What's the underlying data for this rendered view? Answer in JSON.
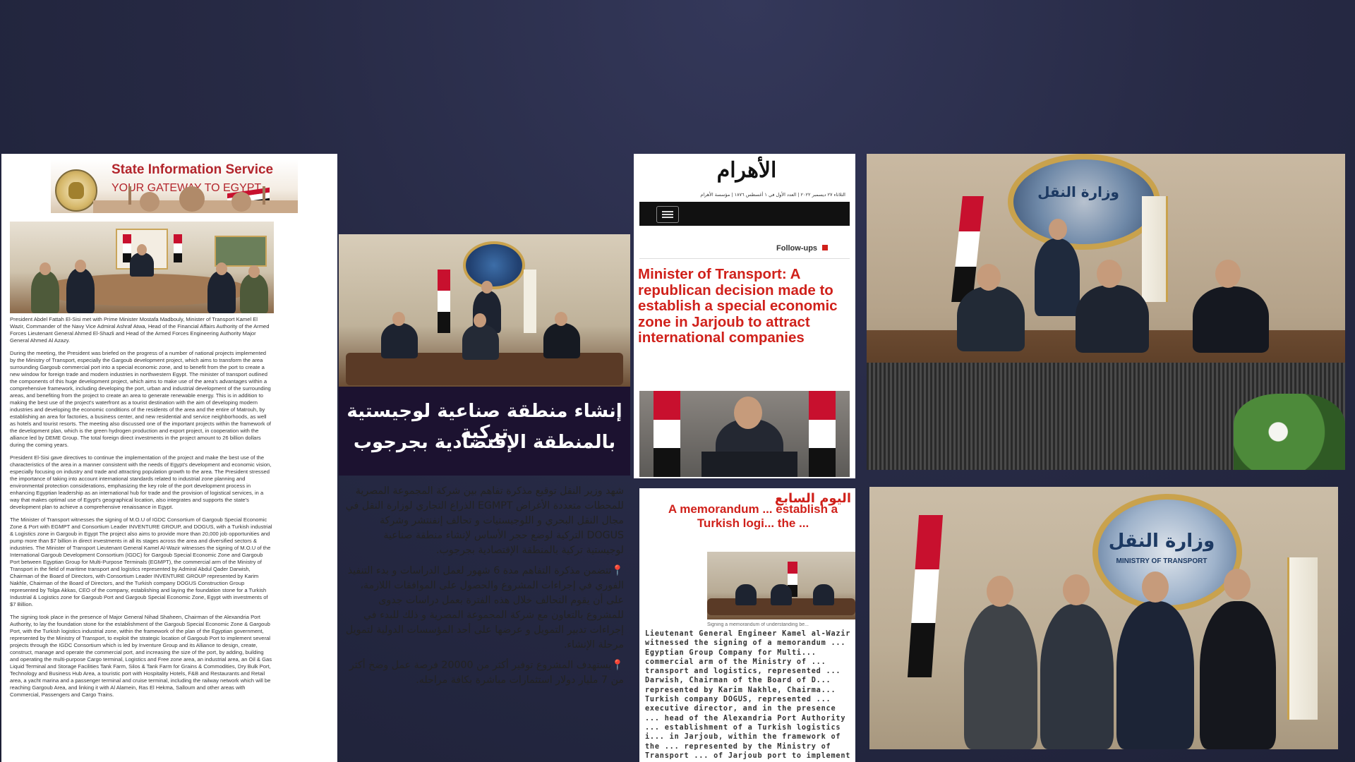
{
  "sis": {
    "title": "State Information Service",
    "subtitle": "YOUR GATEWAY TO EGYPT"
  },
  "article1": {
    "caption": "President Abdel Fattah El-Sisi met with Prime Minister Mostafa Madbouly, Minister of Transport Kamel El Wazir, Commander of the Navy Vice Admiral Ashraf Atwa, Head of the Financial Affairs Authority of the Armed Forces Lieutenant General Ahmed El-Shazli and Head of the Armed Forces Engineering Authority Major General Ahmed Al Azazy.",
    "p1": "During the meeting, the President was briefed on the progress of a number of national projects implemented by the Ministry of Transport, especially the Gargoub development project, which aims to transform the area surrounding Gargoub commercial port into a special economic zone, and to benefit from the port to create a new window for foreign trade and modern industries in northwestern Egypt. The minister of transport outlined the components of this huge development project, which aims to make use of the area's advantages within a comprehensive framework, including developing the port, urban and industrial development of the surrounding areas, and benefiting from the project to create an area to generate renewable energy. This is in addition to making the best use of the project's waterfront as a tourist destination with the aim of developing modern industries and developing the economic conditions of the residents of the area and the entire of Matrouh, by establishing an area for factories, a business center, and new residential and service neighborhoods, as well as hotels and tourist resorts. The meeting also discussed one of the important projects within the framework of the development plan, which is the green hydrogen production and export project, in cooperation with the alliance led by DEME Group. The total foreign direct investments in the project amount to 26 billion dollars during the coming years.",
    "p2": "President El-Sisi gave directives to continue the implementation of the project and make the best use of the characteristics of the area in a manner consistent with the needs of Egypt's development and economic vision, especially focusing on industry and trade and attracting population growth to the area. The President stressed the importance of taking into account international standards related to industrial zone planning and environmental protection considerations, emphasizing the key role of the port development process in enhancing Egyptian leadership as an international hub for trade and the provision of logistical services, in a way that makes optimal use of Egypt's geographical location, also integrates and supports the state's development plan to achieve a comprehensive renaissance in Egypt.",
    "p3": "The Minister of Transport witnesses the signing of M.O.U of IGDC Consortium of Gargoub Special Economic Zone & Port with EGMPT and Consortium Leader INVENTURE GROUP, and DOGUS, with a Turkish industrial & Logistics zone in Gargoub in Egypt The project also aims to provide more than 20,000 job opportunities and pump more than $7 billion in direct investments in all its stages across the area and diversified sectors & industries. The Minister of Transport Lieutenant General Kamel Al-Wazir witnesses the signing of M.O.U of the International Gargoub Development Consortium (IGDC) for Gargoub Special Economic Zone and Gargoub Port between Egyptian Group for Multi-Purpose Terminals (EGMPT), the commercial arm of the Ministry of Transport in the field of maritime transport and logistics represented by Admiral Abdul Qader Darwish, Chairman of the Board of Directors, with Consortium Leader INVENTURE GROUP represented by Karim Nakhle, Chairman of the Board of Directors, and the Turkish company DOGUS Construction Group represented by Tolga Akkas, CEO of the company, establishing and laying the foundation stone for a Turkish Industrial & Logistics zone for Gargoub Port and Gargoub Special Economic Zone, Egypt with investments of $7 Billion.",
    "p4": "The signing took place in the presence of Major General Nihad Shaheen, Chairman of the Alexandria Port Authority, to lay the foundation stone for the establishment of the Gargoub Special Economic Zone & Gargoub Port, with the Turkish logistics industrial zone, within the framework of the plan of the Egyptian government, represented by the Ministry of Transport, to exploit the strategic location of Gargoub Port to implement several projects through the IGDC Consortium which is led by Inventure Group and its Alliance to design, create, construct, manage and operate the commercial port, and increasing the size of the port, by adding, building and operating the multi-purpose Cargo terminal, Logistics and Free zone area, an industrial area, an Oil & Gas Liquid Terminal and Storage Facilities Tank Farm, Silos & Tank Farm for Grains & Commodities, Dry Bulk Port, Technology and Business Hub Area, a touristic port with Hospitality Hotels, F&B and Restaurants and Retail area, a yacht marina and a passenger terminal and cruise terminal, including the railway network which will be reaching Gargoub Area, and linking it with Al Alamein, Ras El Hekma, Salloum and other areas with Commercial, Passengers and Cargo Trains."
  },
  "article2": {
    "video_title_line1": "إنشاء منطقة صناعية لوجيستية تركية",
    "video_title_line2": "بالمنطقة الإقتصادية بجرجوب",
    "p1": "شهد وزير النقل توقيع مذكرة تفاهم بين شركة المجموعة المصرية للمحطات متعددة الأغراض EGMPT الذراع التجاري لوزارة النقل في مجال النقل البحري و اللوجيستيات و تحالف إنفنتشر وشركة DOGUS التركية لوضع حجر الأساس لإنشاء منطقة صناعية لوجيستية تركية بالمنطقة الإقتصادية بجرجوب.",
    "p2": "📍تتضمن مذكرة التفاهم مدة 6 شهور لعمل الدراسات و بدء التنفيذ الفوري في إجراءات المشروع والحصول على الموافقات اللازمة، على أن يقوم التحالف خلال هذه الفترة بعمل دراسات جدوى للمشروع بالتعاون مع شركة المجموعة المصرية و ذلك للبدء في إجراءات تدبير التمويل و عرضها على أحد المؤسسات الدولية لتمويل مرحلة الإنشاء.",
    "p3": "📍يستهدف المشروع توفير أكثر من 20000 فرصة عمل وضخ أكثر من 7 مليار دولار استثمارات مباشرة بكافة مراحله."
  },
  "article3": {
    "masthead": "الأهرام",
    "dateline": "الثلاثاء ٢٧ ديسمبر ٢٠٢٢ | العدد الأول في ١ أغسطس ١٨٧٦ | مؤسسة الأهرام",
    "menu_icon": "hamburger-icon",
    "follow_ups": "Follow-ups",
    "headline": "Minister of Transport: A republican decision made to establish a special economic zone in Jarjoub to attract international companies"
  },
  "article4": {
    "masthead": "اليوم السابع",
    "headline": "A memorandum ... establish a Turkish logi... the ...",
    "photo_caption": "Signing a memorandum of understanding be...",
    "body": "Lieutenant General Engineer Kamel al-Wazir witnessed the signing of a memorandum ... Egyptian Group Company for Multi... commercial arm of the Ministry of ... transport and logistics, represented ... Darwish, Chairman of the Board of D... represented by Karim Nakhle, Chairma... Turkish company DOGUS, represented ... executive director, and in the presence ... head of the Alexandria Port Authority ... establishment of a Turkish logistics i... in Jarjoub, within the framework of the ... represented by the Ministry of Transport ... of Jarjoub port to implement several ... design, construct, manage and ope... logistical zones, linking them to the ra..."
  },
  "photos": {
    "ministry_sign_ar": "وزارة النقل",
    "ministry_sign_en": "MINISTRY OF TRANSPORT"
  },
  "colors": {
    "background": "#272a45",
    "sis_red": "#b3262d",
    "headline_red": "#d0211b",
    "flag_red": "#c8102e"
  }
}
